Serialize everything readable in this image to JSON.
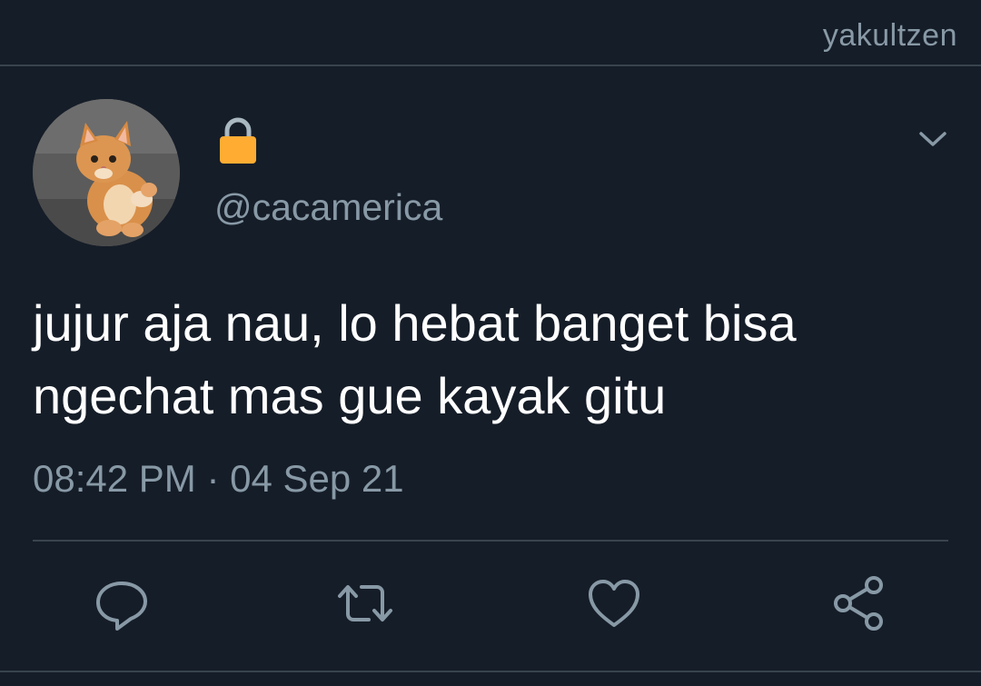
{
  "watermark": "yakultzen",
  "tweet": {
    "display_name_icon": "lock-icon",
    "handle": "@cacamerica",
    "text": "jujur aja nau, lo hebat banget bisa ngechat mas gue kayak gitu",
    "timestamp": "08:42 PM · 04 Sep 21"
  },
  "actions": [
    "reply-icon",
    "retweet-icon",
    "like-icon",
    "share-icon"
  ],
  "colors": {
    "background": "#151d28",
    "muted_text": "#8899a6",
    "divider": "#38444d",
    "lock": "#ffac33"
  }
}
